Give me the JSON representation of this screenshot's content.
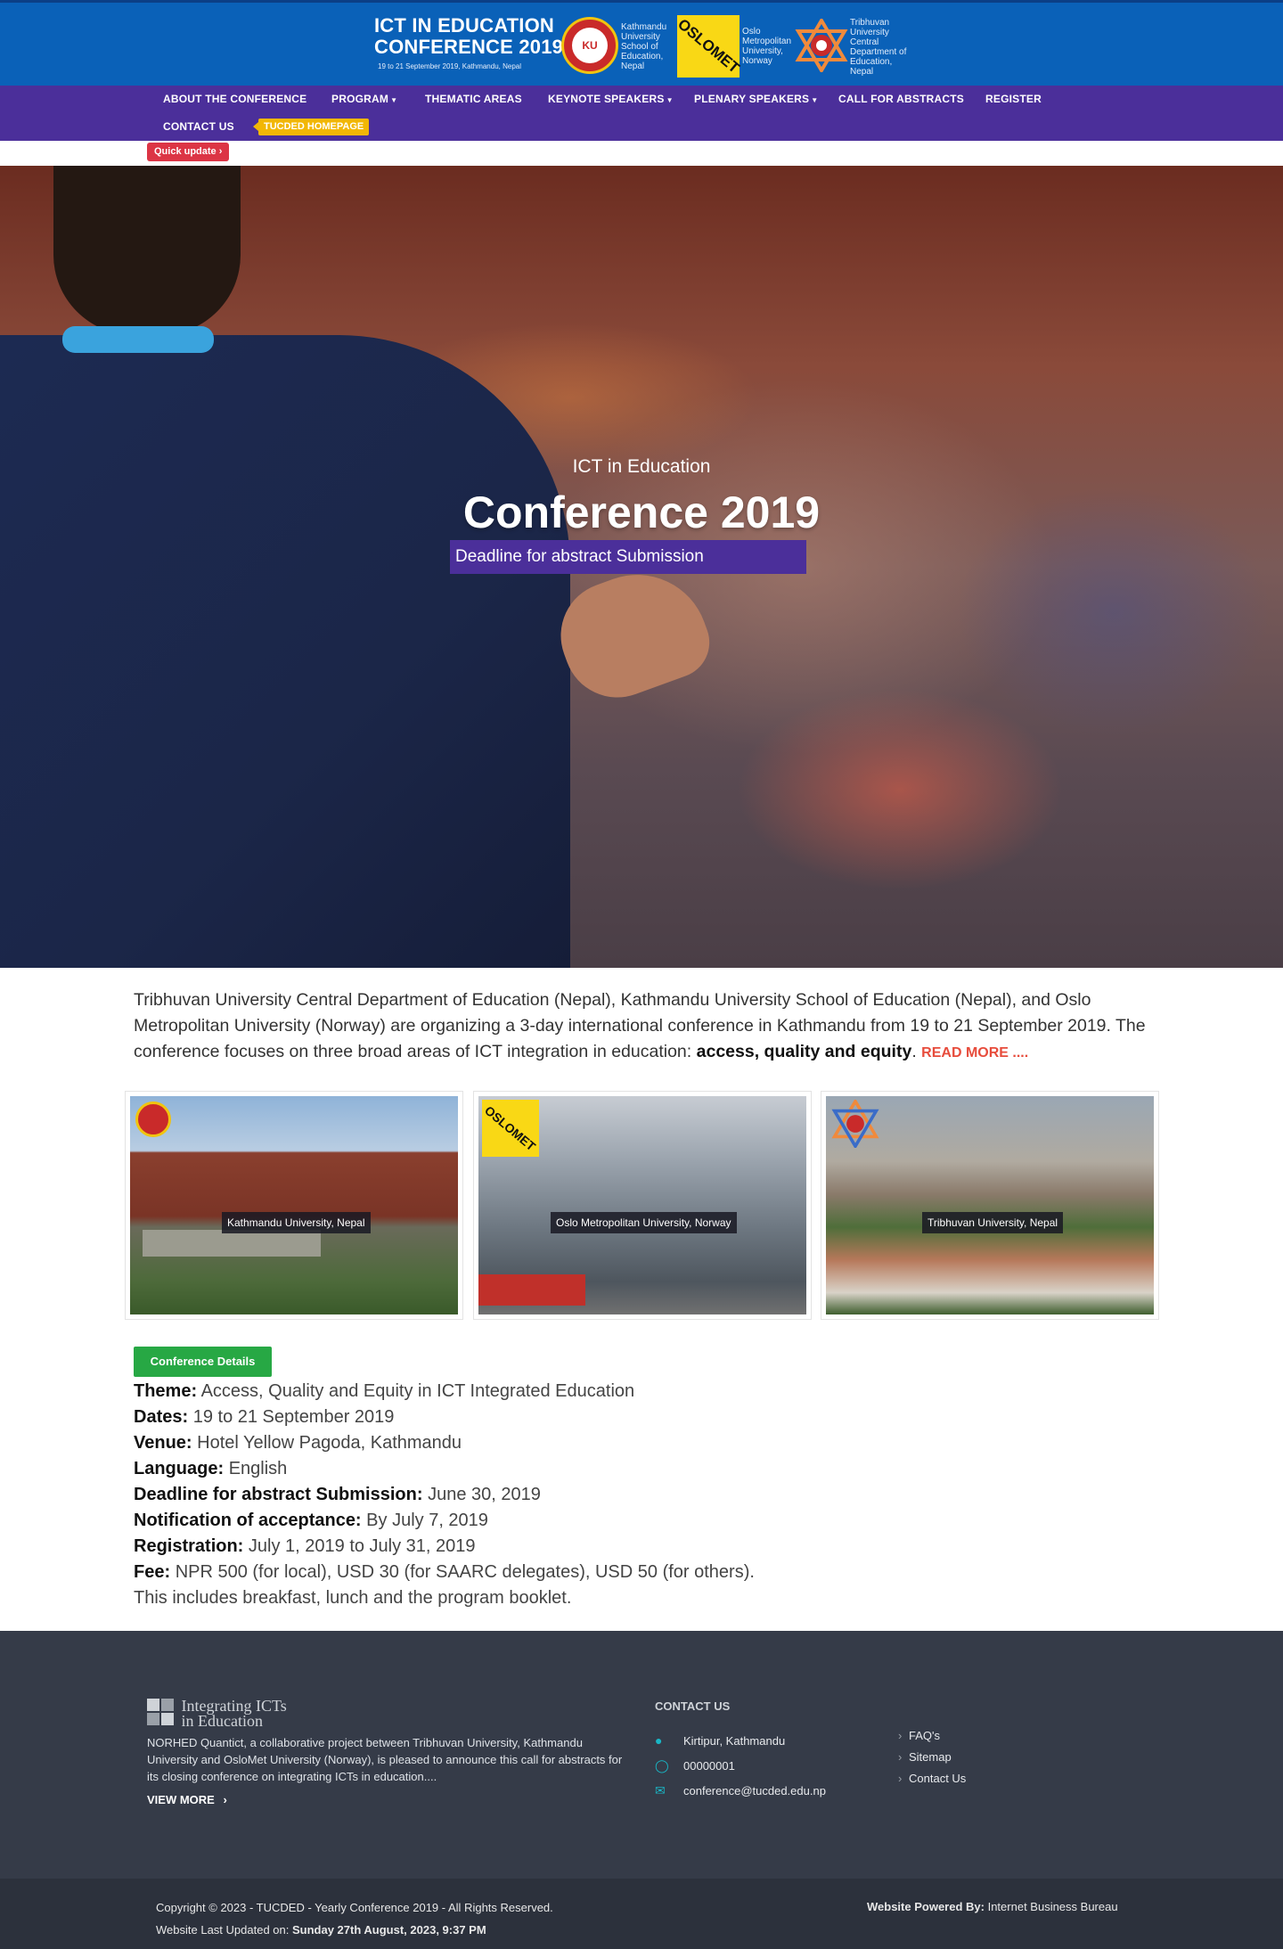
{
  "header": {
    "title_line1": "ICT IN EDUCATION",
    "title_line2": "CONFERENCE 2019",
    "subtitle": "19 to 21 September 2019, Kathmandu, Nepal",
    "logos": [
      {
        "text": "Kathmandu University School of Education, Nepal"
      },
      {
        "text": "Oslo Metropolitan University, Norway",
        "mark": "OSLOMET"
      },
      {
        "text": "Tribhuvan University Central Department of Education, Nepal"
      }
    ],
    "header_color": "#0a61b8"
  },
  "nav": {
    "items": [
      {
        "label": "ABOUT THE CONFERENCE",
        "dropdown": false
      },
      {
        "label": "PROGRAM",
        "dropdown": true
      },
      {
        "label": "THEMATIC AREAS",
        "dropdown": false
      },
      {
        "label": "KEYNOTE SPEAKERS",
        "dropdown": true
      },
      {
        "label": "PLENARY SPEAKERS",
        "dropdown": true
      },
      {
        "label": "CALL FOR ABSTRACTS",
        "dropdown": false
      },
      {
        "label": "REGISTER",
        "dropdown": false
      },
      {
        "label": "CONTACT US",
        "dropdown": false
      }
    ],
    "badge": "TUCDED HOMEPAGE",
    "quick_update": "Quick update ›",
    "nav_color": "#4b2f9a"
  },
  "hero": {
    "small": "ICT in Education",
    "big": "Conference 2019",
    "box": "Deadline for abstract Submission"
  },
  "intro": {
    "text": "Tribhuvan University Central Department of Education (Nepal), Kathmandu University School of Education (Nepal), and Oslo Metropolitan University (Norway) are organizing a 3-day international conference in Kathmandu from 19 to 21 September 2019. The conference focuses on three broad areas of ICT integration in education: ",
    "bold": "access, quality and equity",
    "after": ".",
    "more": "READ MORE ...."
  },
  "universities": [
    {
      "caption": "Kathmandu University, Nepal"
    },
    {
      "caption": "Oslo Metropolitan University, Norway"
    },
    {
      "caption": "Tribhuvan University, Nepal"
    }
  ],
  "details": {
    "button": "Conference Details",
    "rows": [
      {
        "label": "Theme:",
        "value": "Access, Quality and Equity in ICT Integrated Education"
      },
      {
        "label": "Dates:",
        "value": "19 to 21 September 2019"
      },
      {
        "label": "Venue:",
        "value": "Hotel Yellow Pagoda, Kathmandu"
      },
      {
        "label": "Language:",
        "value": "English"
      },
      {
        "label": "Deadline for abstract Submission:",
        "value": "June 30, 2019"
      },
      {
        "label": "Notification of acceptance:",
        "value": "By July 7, 2019"
      },
      {
        "label": "Registration:",
        "value": "July 1, 2019 to July 31, 2019"
      },
      {
        "label": "Fee:",
        "value": "NPR 500 (for local), USD 30 (for SAARC delegates), USD 50 (for others). This includes breakfast, lunch and the program booklet."
      }
    ]
  },
  "footer": {
    "logo_line1": "Integrating ICTs",
    "logo_line2": "in Education",
    "description": "NORHED Quantict, a collaborative project between Tribhuvan University, Kathmandu University and OsloMet University (Norway), is pleased to announce this call for abstracts for its closing conference on integrating ICTs in education....",
    "view_more": "VIEW MORE",
    "contact_title": "CONTACT US",
    "contact": [
      {
        "icon": "map-marker-icon",
        "text": "Kirtipur, Kathmandu"
      },
      {
        "icon": "whatsapp-icon",
        "text": "00000001"
      },
      {
        "icon": "envelope-icon",
        "text": "conference@tucded.edu.np"
      }
    ],
    "links": [
      "FAQ's",
      "Sitemap",
      "Contact Us"
    ],
    "copyright": "Copyright © 2023 - TUCDED - Yearly Conference 2019 - All Rights Reserved.",
    "updated_label": "Website Last Updated on:",
    "updated_value": "Sunday 27th August, 2023, 9:37 PM",
    "powered_label": "Website Powered By:",
    "powered_value": "Internet Business Bureau"
  }
}
